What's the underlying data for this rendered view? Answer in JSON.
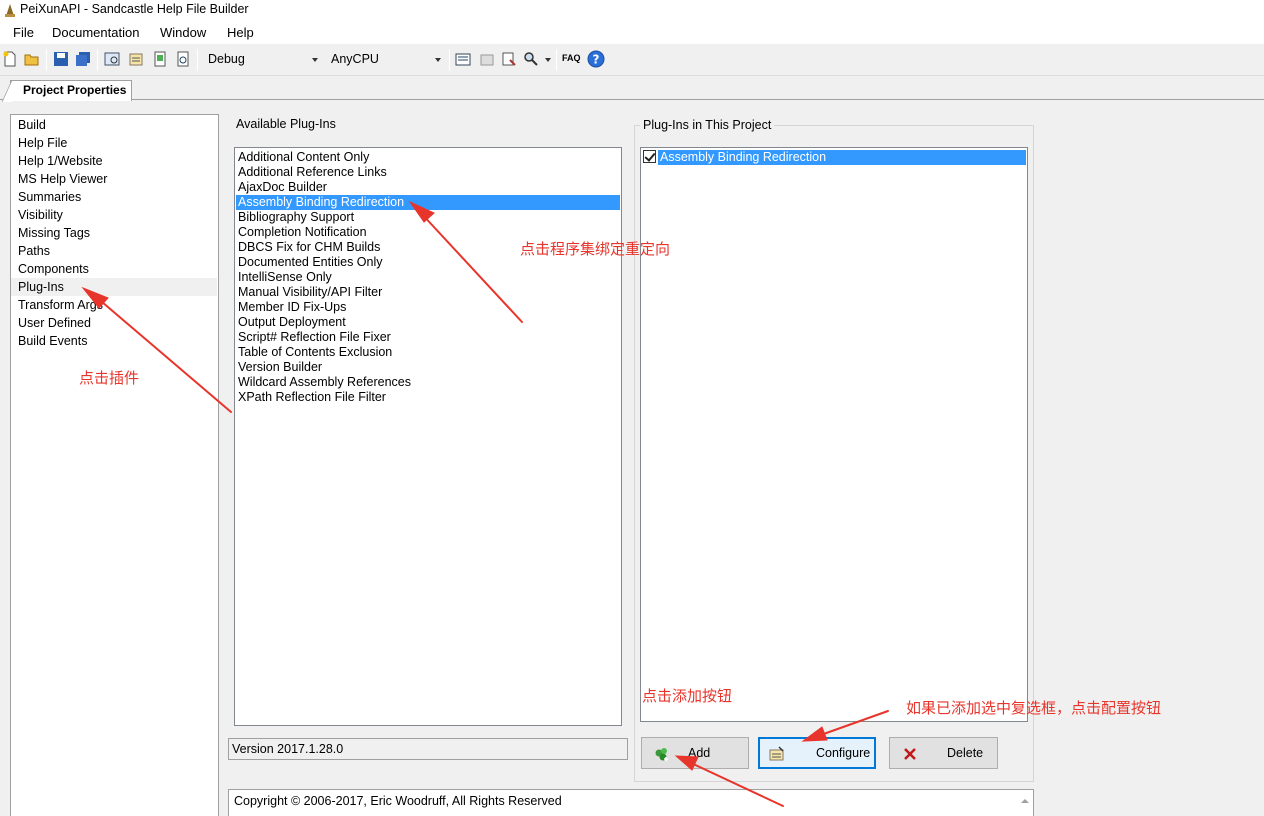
{
  "window": {
    "title": "PeiXunAPI - Sandcastle Help File Builder"
  },
  "menu": [
    "File",
    "Documentation",
    "Window",
    "Help"
  ],
  "toolbar": {
    "configuration": "Debug",
    "platform": "AnyCPU",
    "faq_label": "FAQ"
  },
  "tabs": {
    "project_properties": "Project Properties"
  },
  "nav": {
    "items": [
      "Build",
      "Help File",
      "Help 1/Website",
      "MS Help Viewer",
      "Summaries",
      "Visibility",
      "Missing Tags",
      "Paths",
      "Components",
      "Plug-Ins",
      "Transform Args",
      "User Defined",
      "Build Events"
    ],
    "selected": "Plug-Ins"
  },
  "available": {
    "title": "Available Plug-Ins",
    "items": [
      "Additional Content Only",
      "Additional Reference Links",
      "AjaxDoc Builder",
      "Assembly Binding Redirection",
      "Bibliography Support",
      "Completion Notification",
      "DBCS Fix for CHM Builds",
      "Documented Entities Only",
      "IntelliSense Only",
      "Manual Visibility/API Filter",
      "Member ID Fix-Ups",
      "Output Deployment",
      "Script# Reflection File Fixer",
      "Table of Contents Exclusion",
      "Version Builder",
      "Wildcard Assembly References",
      "XPath Reflection File Filter"
    ],
    "selected": "Assembly Binding Redirection",
    "version": "Version 2017.1.28.0"
  },
  "project_plugins": {
    "title": "Plug-Ins in This Project",
    "items": [
      {
        "label": "Assembly Binding Redirection",
        "checked": true
      }
    ]
  },
  "buttons": {
    "add": "Add",
    "configure": "Configure",
    "delete": "Delete"
  },
  "copyright": "Copyright © 2006-2017, Eric Woodruff, All Rights Reserved",
  "annotations": {
    "click_plugins": "点击插件",
    "click_assembly": "点击程序集绑定重定向",
    "click_add": "点击添加按钮",
    "click_configure": "如果已添加选中复选框，点击配置按钮"
  },
  "colors": {
    "selection": "#3399ff",
    "annotation": "#e8352b",
    "focus": "#0078d7"
  }
}
